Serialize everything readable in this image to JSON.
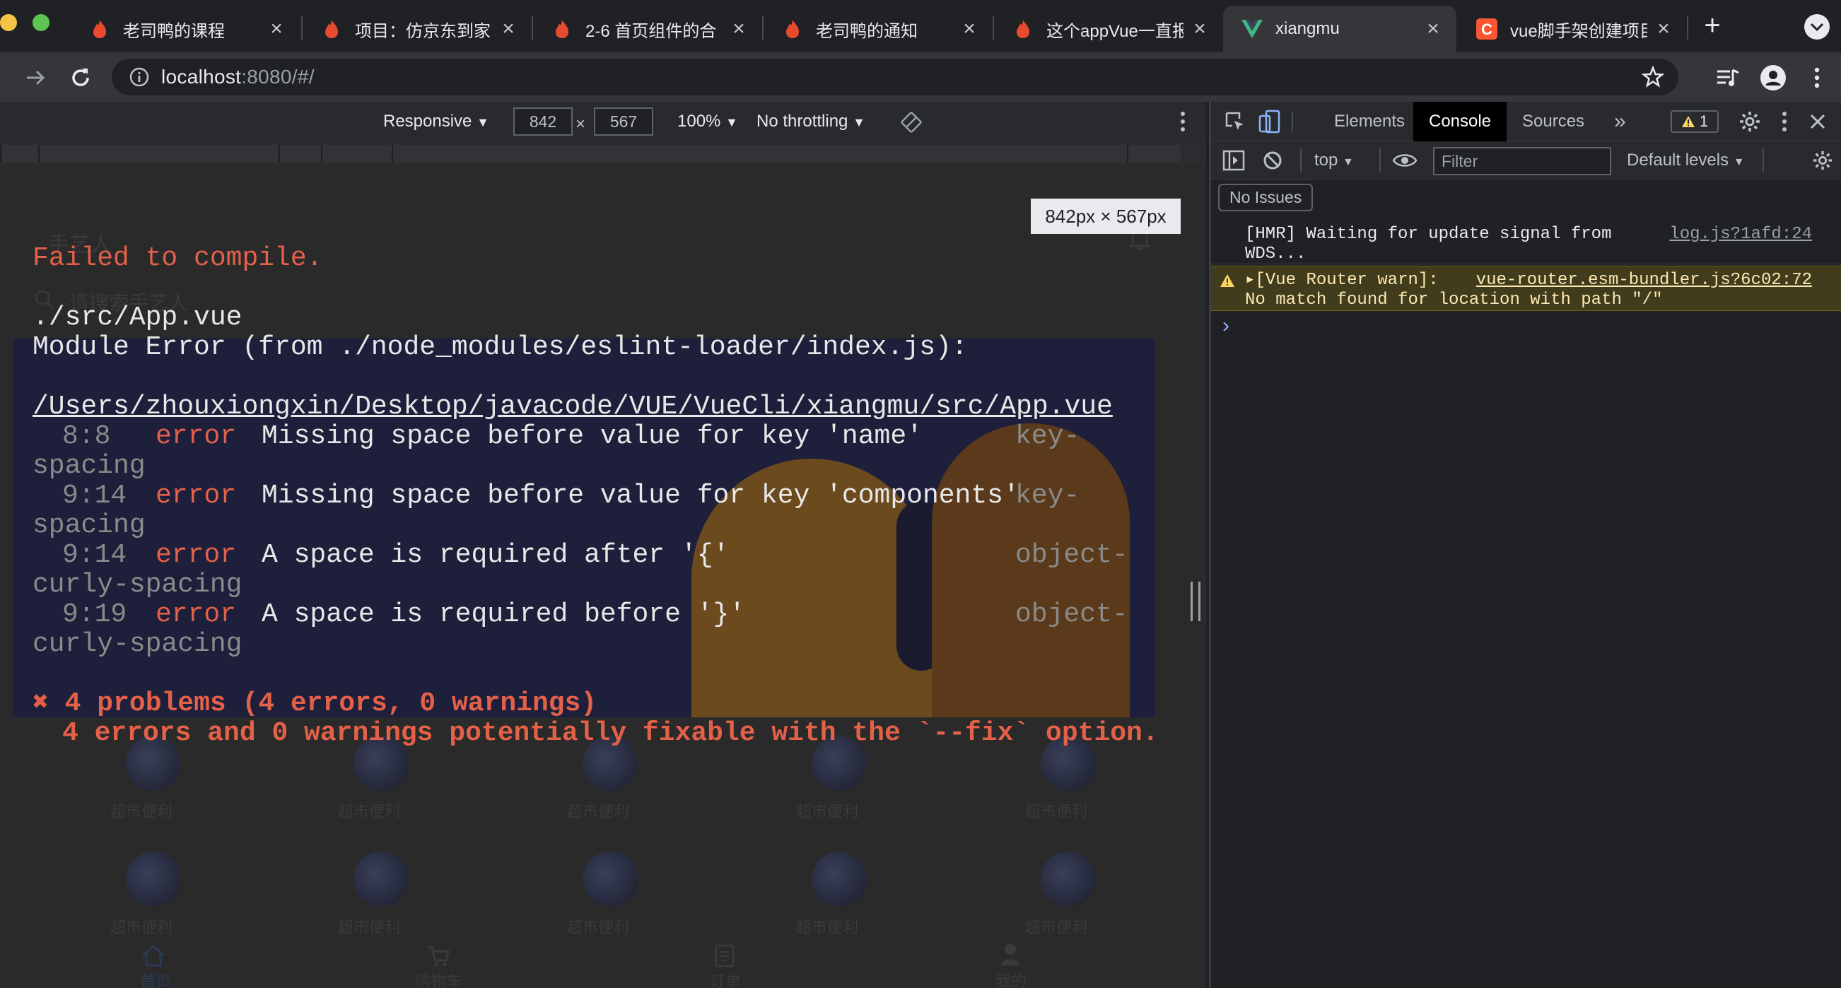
{
  "browser": {
    "tabs": [
      {
        "title": "老司鸭的课程",
        "favicon": "flame-icon"
      },
      {
        "title": "项目：仿京东到家",
        "favicon": "flame-icon"
      },
      {
        "title": "2-6 首页组件的合",
        "favicon": "flame-icon"
      },
      {
        "title": "老司鸭的通知",
        "favicon": "flame-icon"
      },
      {
        "title": "这个appVue一直报",
        "favicon": "flame-icon"
      },
      {
        "title": "xiangmu",
        "favicon": "vue-logo-icon",
        "active": true
      },
      {
        "title": "vue脚手架创建项目",
        "favicon": "csdn-logo-icon"
      }
    ],
    "new_tab": "+",
    "address": {
      "host": "localhost",
      "rest": ":8080/#/"
    }
  },
  "device_toolbar": {
    "mode": "Responsive",
    "width": "842",
    "height": "567",
    "times": "×",
    "zoom": "100%",
    "throttling": "No throttling"
  },
  "size_tooltip": "842px × 567px",
  "app_page": {
    "location_label": "手艺人",
    "search_placeholder": "请搜索手艺人",
    "grid_label": "超市便利",
    "nav": [
      "首页",
      "购物车",
      "订单",
      "我的"
    ]
  },
  "error_overlay": {
    "title": "Failed to compile.",
    "file": "./src/App.vue",
    "module_error": "Module Error (from ./node_modules/eslint-loader/index.js):",
    "path": "/Users/zhouxiongxin/Desktop/javacode/VUE/VueCli/xiangmu/src/App.vue",
    "errors": [
      {
        "loc": "8:8",
        "level": "error",
        "message": "Missing space before value for key 'name'",
        "rule": "key-",
        "rule_cont": "spacing"
      },
      {
        "loc": "9:14",
        "level": "error",
        "message": "Missing space before value for key 'components'",
        "rule": "key-",
        "rule_cont": "spacing"
      },
      {
        "loc": "9:14",
        "level": "error",
        "message": "A space is required after '{'",
        "rule": "object-",
        "rule_cont": "curly-spacing"
      },
      {
        "loc": "9:19",
        "level": "error",
        "message": "A space is required before '}'",
        "rule": "object-",
        "rule_cont": "curly-spacing"
      }
    ],
    "summary": "✖ 4 problems (4 errors, 0 warnings)",
    "fixable": "4 errors and 0 warnings potentially fixable with the `--fix` option."
  },
  "devtools": {
    "tabs": [
      "Elements",
      "Console",
      "Sources"
    ],
    "more": "»",
    "warning_count": "1",
    "context": "top",
    "filter_placeholder": "Filter",
    "levels": "Default levels",
    "issues": "No Issues",
    "logs": [
      {
        "text1": "[HMR] Waiting for update signal from",
        "text2": "WDS...",
        "source": "log.js?1afd:24",
        "level": "info"
      },
      {
        "text1": "▸[Vue Router warn]:",
        "text2": "No match found for location with path \"/\"",
        "source": "vue-router.esm-bundler.js?6c02:72",
        "level": "warning"
      }
    ],
    "prompt": "›"
  },
  "colors": {
    "error_red": "#e36049",
    "warning_bg": "#413c1c",
    "console_active": "#000000"
  }
}
